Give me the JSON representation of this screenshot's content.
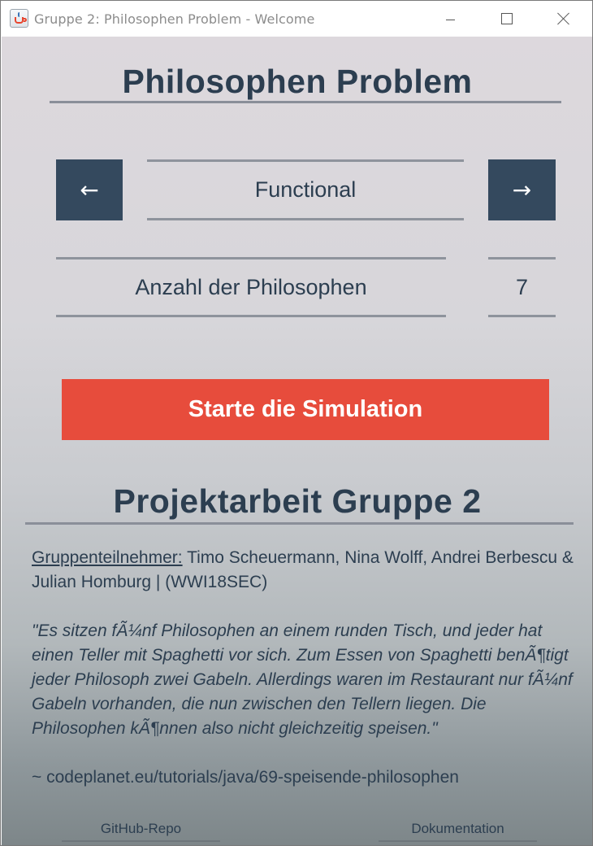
{
  "window": {
    "title": "Gruppe 2: Philosophen Problem - Welcome",
    "icon": "java-cup-icon"
  },
  "header": {
    "title": "Philosophen Problem"
  },
  "mode_selector": {
    "prev_label": "←",
    "value": "Functional",
    "next_label": "→"
  },
  "philosopher_count": {
    "label": "Anzahl der Philosophen",
    "value": "7"
  },
  "start_button": {
    "label": "Starte die Simulation"
  },
  "project": {
    "title": "Projektarbeit Gruppe 2",
    "members_label": "Gruppenteilnehmer:",
    "members": " Timo Scheuermann, Nina Wolff, Andrei Berbescu & Julian Homburg | (WWI18SEC)",
    "quote": "\"Es sitzen fÃ¼nf Philosophen an einem runden Tisch, und jeder hat einen Teller mit Spaghetti vor sich. Zum Essen von Spaghetti benÃ¶tigt jeder Philosoph zwei Gabeln. Allerdings waren im Restaurant nur fÃ¼nf Gabeln vorhanden, die nun zwischen den Tellern liegen. Die Philosophen kÃ¶nnen also nicht gleichzeitig speisen.\"",
    "source": "~ codeplanet.eu/tutorials/java/69-speisende-philosophen"
  },
  "footer": {
    "github_label": "GitHub-Repo",
    "docs_label": "Dokumentation"
  },
  "colors": {
    "primary": "#2c3e50",
    "nav_button": "#34495e",
    "start_button": "#e74c3c"
  }
}
